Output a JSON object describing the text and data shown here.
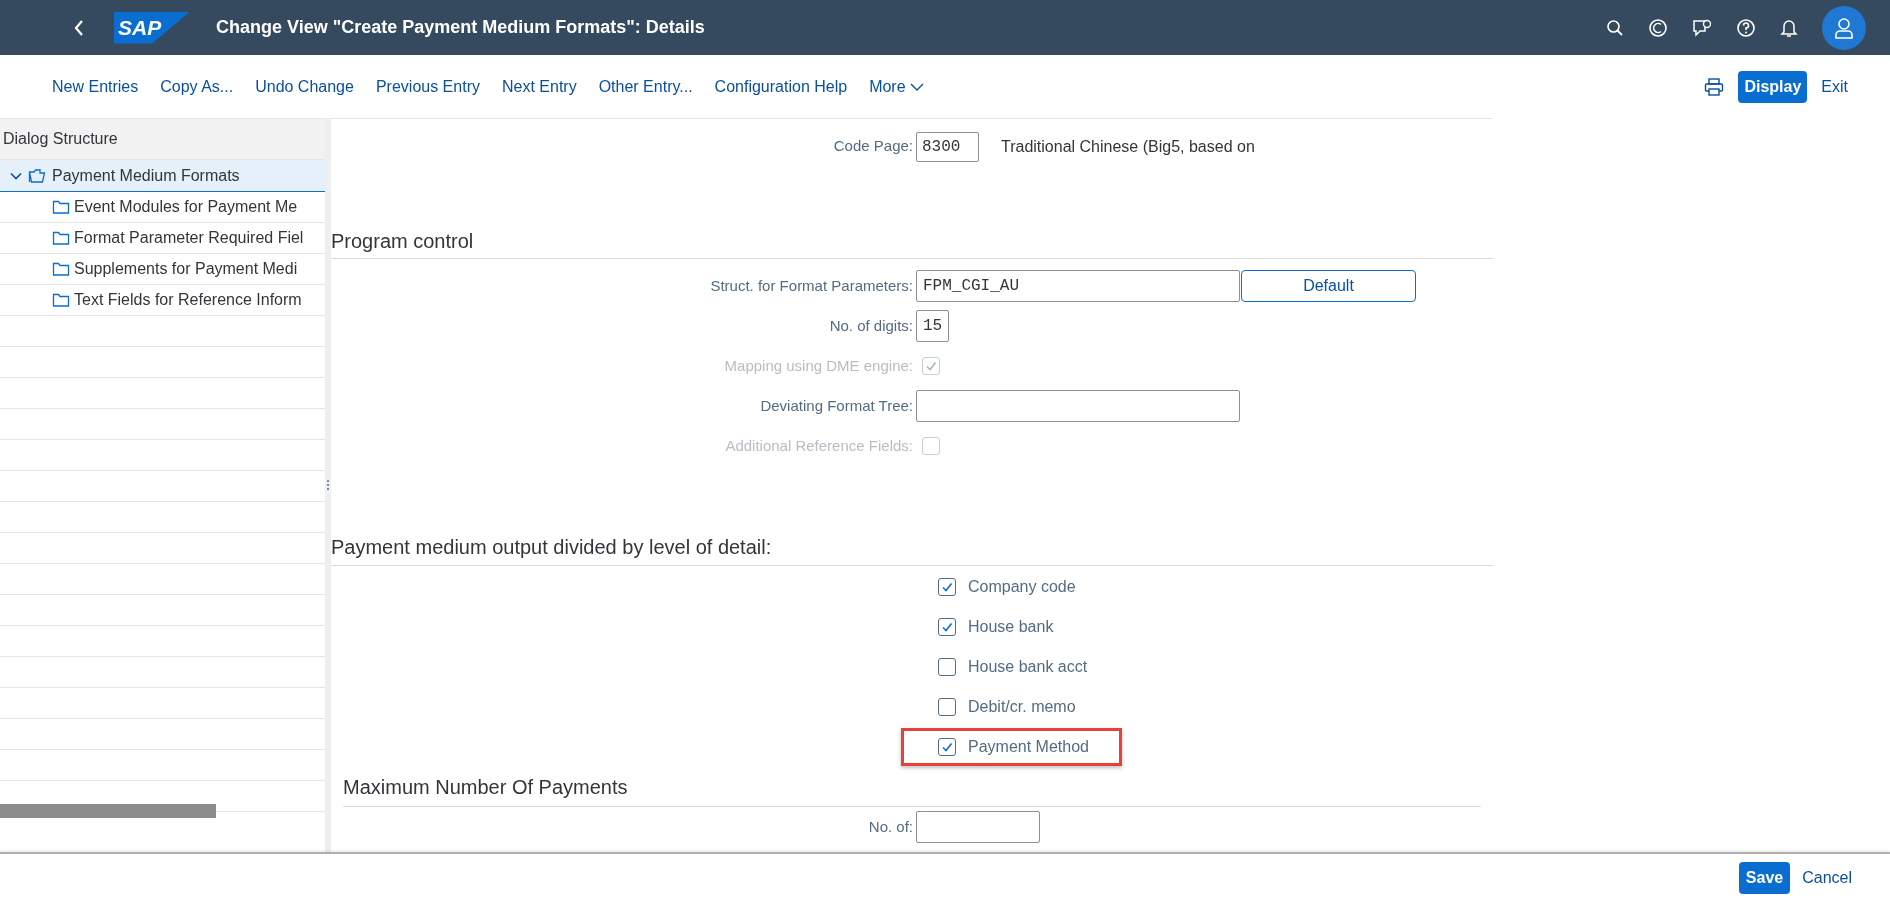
{
  "shell_bar": {
    "logo": "SAP",
    "title": "Change View \"Create Payment Medium Formats\": Details"
  },
  "toolbar": {
    "items": [
      "New Entries",
      "Copy As...",
      "Undo Change",
      "Previous Entry",
      "Next Entry",
      "Other Entry...",
      "Configuration Help"
    ],
    "more": "More",
    "display": "Display",
    "exit": "Exit"
  },
  "dialog_structure": {
    "title": "Dialog Structure",
    "items": [
      {
        "label": "Payment Medium Formats",
        "expanded": true,
        "selected": true,
        "children": [
          {
            "label": "Event Modules for Payment Me",
            "selected": false
          },
          {
            "label": "Format Parameter Required Fiel",
            "selected": false
          },
          {
            "label": "Supplements for Payment Medi",
            "selected": false
          },
          {
            "label": "Text Fields for Reference Inform",
            "selected": false
          }
        ]
      }
    ]
  },
  "code_page": {
    "label": "Code Page:",
    "value": "8300",
    "description": "Traditional Chinese (Big5, based on"
  },
  "program_control": {
    "title": "Program control",
    "fields": [
      {
        "kind": "text_field",
        "label": "Struct. for Format Parameters:",
        "value": "FPM_CGI_AU",
        "button": "Default"
      },
      {
        "kind": "number_field",
        "label": "No. of digits:",
        "value": "15"
      },
      {
        "kind": "checkbox",
        "label": "Mapping using DME engine:",
        "checked": true,
        "disabled": true
      },
      {
        "kind": "text_field",
        "label": "Deviating Format Tree:"
      },
      {
        "kind": "checkbox",
        "label": "Additional Reference Fields:",
        "checked": false,
        "disabled": true
      }
    ]
  },
  "level_of_detail": {
    "title": "Payment medium output divided by level of detail:",
    "options": [
      {
        "label": "Company code",
        "checked": true,
        "highlighted": false
      },
      {
        "label": "House bank",
        "checked": true,
        "highlighted": false
      },
      {
        "label": "House bank acct",
        "checked": false,
        "highlighted": false
      },
      {
        "label": "Debit/cr. memo",
        "checked": false,
        "highlighted": false
      },
      {
        "label": "Payment Method",
        "checked": true,
        "highlighted": true
      }
    ]
  },
  "max_payments": {
    "title": "Maximum Number Of Payments",
    "label": "No. of:"
  },
  "footer": {
    "save": "Save",
    "cancel": "Cancel"
  }
}
